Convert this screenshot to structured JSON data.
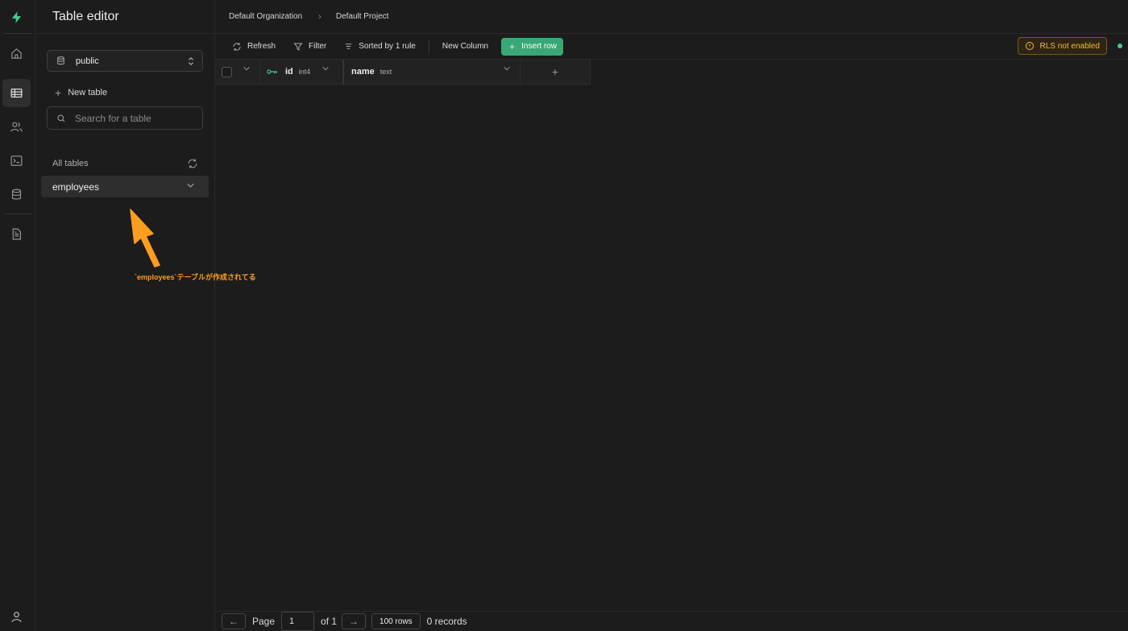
{
  "app": {
    "logo_icon": "supabase-bolt-icon",
    "accent": "#3ecf8e"
  },
  "rail": {
    "items": [
      {
        "icon": "home-icon"
      },
      {
        "icon": "table-icon",
        "active": true
      },
      {
        "icon": "users-icon"
      },
      {
        "icon": "terminal-icon"
      },
      {
        "icon": "database-icon"
      },
      {
        "icon": "document-icon"
      }
    ],
    "bottom_icon": "user-icon"
  },
  "sidebar": {
    "title": "Table editor",
    "schema": "public",
    "new_table_label": "New table",
    "search_placeholder": "Search for a table",
    "all_tables_label": "All tables",
    "tables": [
      {
        "name": "employees",
        "selected": true
      }
    ]
  },
  "annotation": {
    "text": "`employees`テーブルが作成されてる",
    "color": "#ff9d1e"
  },
  "breadcrumb": {
    "organization": "Default Organization",
    "project": "Default Project"
  },
  "toolbar": {
    "refresh_label": "Refresh",
    "filter_label": "Filter",
    "sort_label": "Sorted by 1 rule",
    "new_column_label": "New Column",
    "insert_row_label": "Insert row",
    "rls_label": "RLS not enabled",
    "rls_color": "#f0b84a",
    "status_color": "#3ecf8e"
  },
  "grid": {
    "columns": [
      {
        "name": "id",
        "type": "int4",
        "primary_key": true
      },
      {
        "name": "name",
        "type": "text"
      }
    ],
    "rows": []
  },
  "footer": {
    "page_label": "Page",
    "page_value": "1",
    "of_label": "of 1",
    "rows_label": "100 rows",
    "records_label": "0 records"
  }
}
